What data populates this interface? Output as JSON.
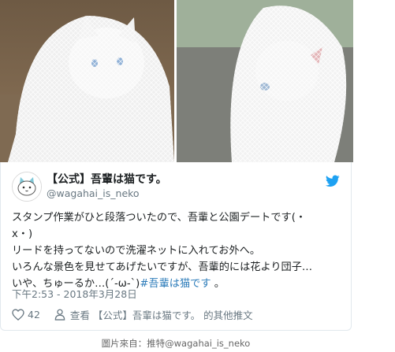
{
  "tweet": {
    "display_name": "【公式】吾輩は猫です。",
    "handle": "@wagahai_is_neko",
    "text_main": "スタンプ作業がひと段落ついたので、吾輩と公園デートです(・\nx・)\nリードを持ってないので洗濯ネットに入れてお外へ。\nいろんな景色を見せてあげたいですが、吾輩的には花より団子…\nいや、ちゅーるか…(´-ω-`)",
    "hashtag": "#吾輩は猫です",
    "text_tail": " 。",
    "timestamp": "下午2:53 - 2018年3月28日",
    "like_count": "42",
    "view_more": "查看 【公式】吾輩は猫です。 的其他推文"
  },
  "caption": "圖片來自：推特@wagahai_is_neko",
  "colors": {
    "twitter_blue": "#1da1f2",
    "link": "#2b7bb9",
    "muted": "#697882",
    "heart": "#e0245e"
  },
  "icons": [
    "avatar-cat",
    "twitter-bird-icon",
    "heart-icon",
    "person-icon"
  ]
}
